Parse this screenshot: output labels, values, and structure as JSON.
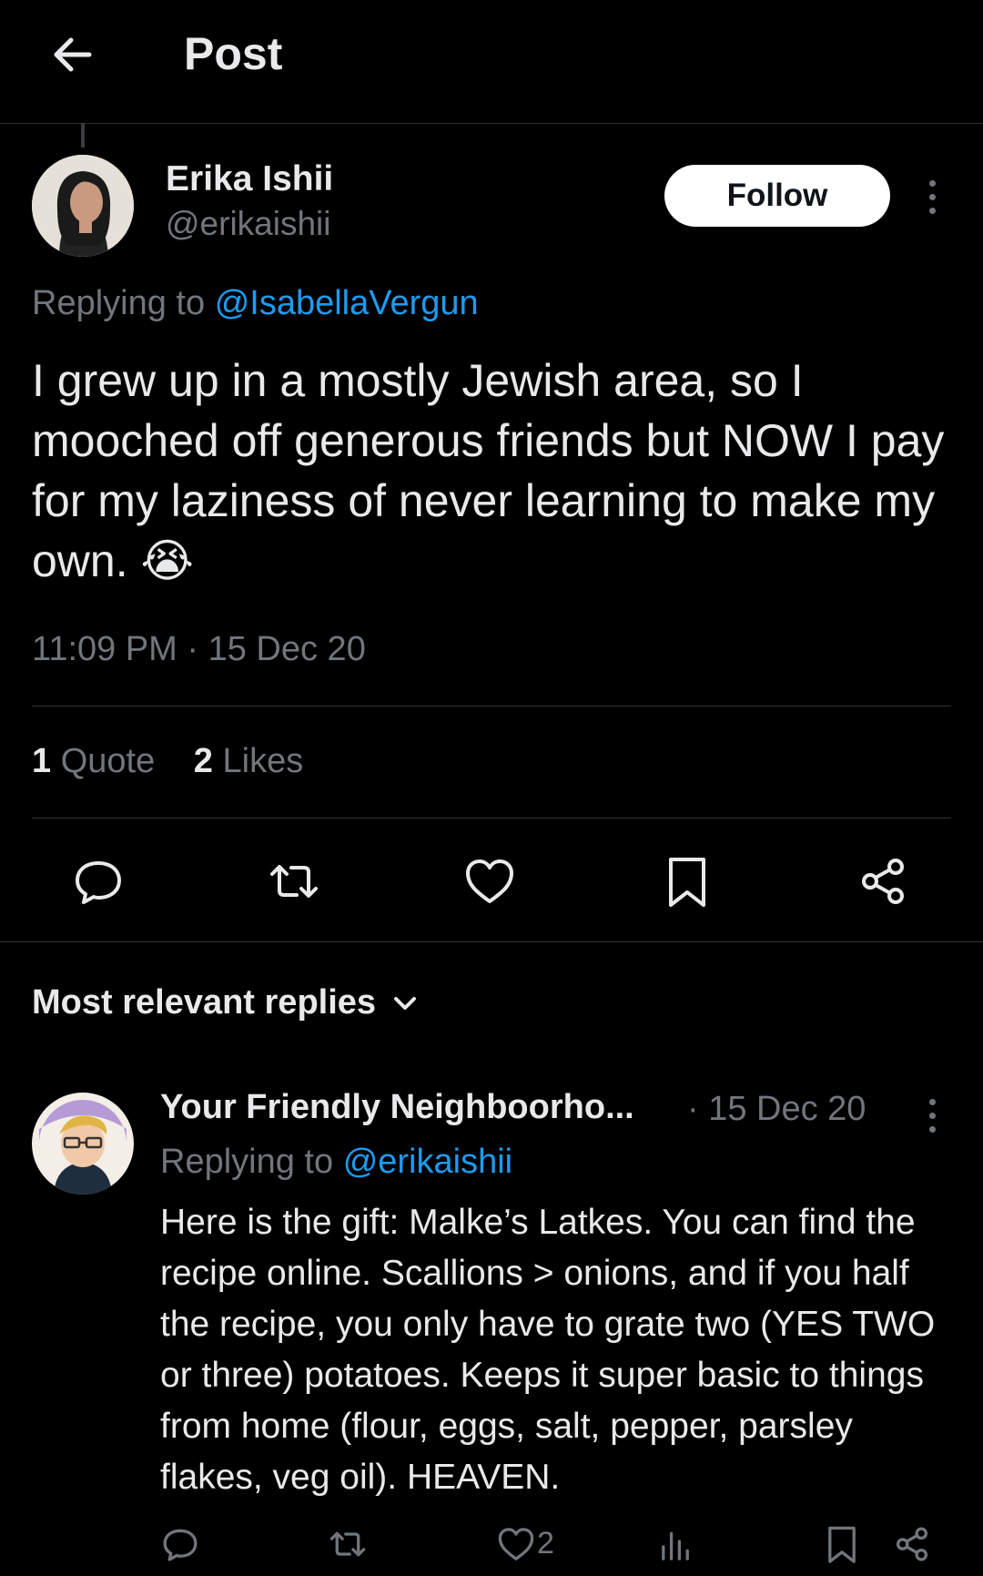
{
  "header": {
    "title": "Post"
  },
  "post": {
    "author_name": "Erika Ishii",
    "author_handle": "@erikaishii",
    "follow_label": "Follow",
    "replying_prefix": "Replying to",
    "replying_handle": "@IsabellaVergun",
    "text": "I grew up in a mostly Jewish area, so I mooched off generous friends but NOW I pay for my laziness of never learning to make my own. 😭",
    "timestamp": "11:09 PM · 15 Dec 20",
    "quote_count": "1",
    "quote_label": "Quote",
    "like_count": "2",
    "like_label": "Likes"
  },
  "replies_section": {
    "label": "Most relevant replies"
  },
  "reply": {
    "author_name": "Your Friendly Neighboorho...",
    "date": "· 15 Dec 20",
    "replying_prefix": "Replying to",
    "replying_handle": "@erikaishii",
    "text": "Here is the gift: Malke’s Latkes. You can find the recipe online. Scallions > onions, and if you half the recipe, you only have to grate two (YES TWO or three) potatoes. Keeps it super basic to things from home (flour, eggs, salt, pepper, parsley flakes, veg oil). HEAVEN.",
    "like_count": "2"
  },
  "colors": {
    "background": "#000000",
    "text": "#e7e9ea",
    "muted": "#71767b",
    "link": "#1d9bf0",
    "divider": "#2f3336"
  }
}
